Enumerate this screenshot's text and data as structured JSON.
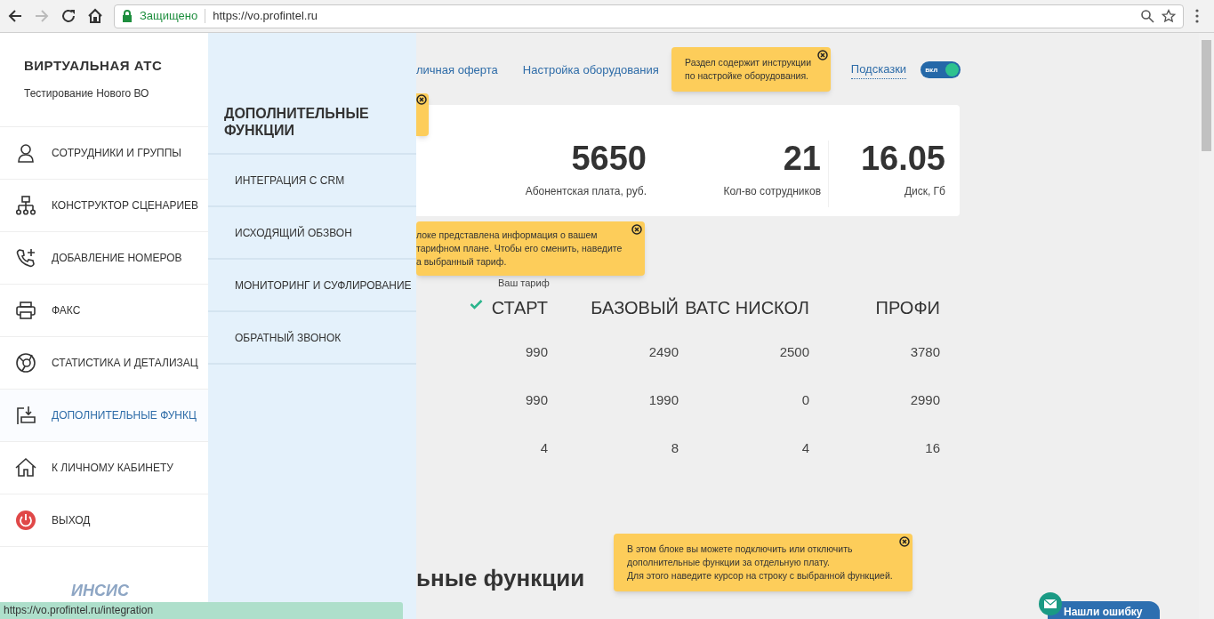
{
  "browser": {
    "secure_label": "Защищено",
    "url": "https://vo.profintel.ru",
    "status_url": "https://vo.profintel.ru/integration"
  },
  "sidebar": {
    "title": "ВИРТУАЛЬНАЯ АТС",
    "subtitle": "Тестирование Нового ВО",
    "items": [
      {
        "label": "СОТРУДНИКИ И ГРУППЫ",
        "selected": false
      },
      {
        "label": "КОНСТРУКТОР СЦЕНАРИЕВ",
        "selected": false
      },
      {
        "label": "ДОБАВЛЕНИЕ НОМЕРОВ",
        "selected": false
      },
      {
        "label": "ФАКС",
        "selected": false
      },
      {
        "label": "СТАТИСТИКА И ДЕТАЛИЗАЦ",
        "selected": false
      },
      {
        "label": "ДОПОЛНИТЕЛЬНЫЕ ФУНКЦ",
        "selected": true
      },
      {
        "label": "К ЛИЧНОМУ КАБИНЕТУ",
        "selected": false
      },
      {
        "label": "ВЫХОД",
        "selected": false
      }
    ],
    "logo": "ИНСИС"
  },
  "submenu": {
    "title": "ДОПОЛНИТЕЛЬНЫЕ ФУНКЦИИ",
    "items": [
      {
        "label": "ИНТЕГРАЦИЯ С CRM"
      },
      {
        "label": "ИСХОДЯЩИЙ ОБЗВОН"
      },
      {
        "label": "МОНИТОРИНГ И СУФЛИРОВАНИЕ"
      },
      {
        "label": "ОБРАТНЫЙ ЗВОНОК"
      }
    ]
  },
  "top_links": [
    {
      "label": "личная оферта"
    },
    {
      "label": "Настройка оборудования"
    }
  ],
  "hints": {
    "label": "Подсказки",
    "toggle_label": "вкл",
    "on": true
  },
  "tooltips": [
    {
      "text": "Раздел содержит инструкции\nпо настройке оборудования."
    },
    {
      "text": "локе представлена информация о вашем\nтарифном плане. Чтобы его сменить, наведите\nа выбранный тариф."
    },
    {
      "text": "В этом блоке вы можете подключить или отключить\nдополнительные функции за отдельную плату.\nДля этого наведите курсор на строку с выбранной функцией."
    }
  ],
  "stats": [
    {
      "value": "5650",
      "label": "Абонентская плата, руб."
    },
    {
      "value": "21",
      "label": "Кол-во сотрудников"
    },
    {
      "value": "16.05",
      "label": "Диск, Гб"
    }
  ],
  "tariffs": {
    "caption": "Ваш тариф",
    "columns": [
      {
        "name": "СТАРТ",
        "selected": true
      },
      {
        "name": "БАЗОВЫЙ",
        "selected": false
      },
      {
        "name": "ВАТС НИСКОЛ",
        "selected": false
      },
      {
        "name": "ПРОФИ",
        "selected": false
      }
    ],
    "rows": [
      [
        "990",
        "2490",
        "2500",
        "3780"
      ],
      [
        "990",
        "1990",
        "0",
        "2990"
      ],
      [
        "4",
        "8",
        "4",
        "16"
      ]
    ]
  },
  "section_heading": "ьные функции",
  "feedback_button": "Нашли ошибку"
}
